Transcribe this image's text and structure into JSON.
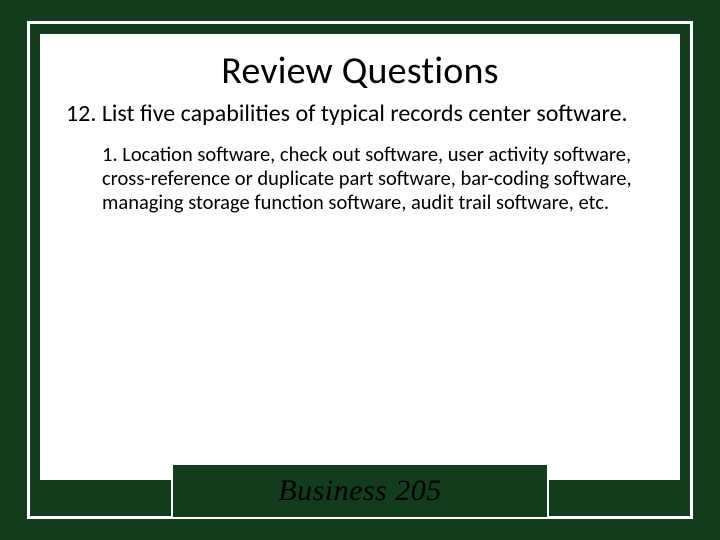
{
  "slide": {
    "title": "Review Questions",
    "question": "12. List five capabilities of typical records center software.",
    "answer": "1. Location software, check out software, user activity software, cross-reference or duplicate part software, bar-coding  software, managing storage function software, audit trail software, etc.",
    "footer": "Business 205"
  }
}
